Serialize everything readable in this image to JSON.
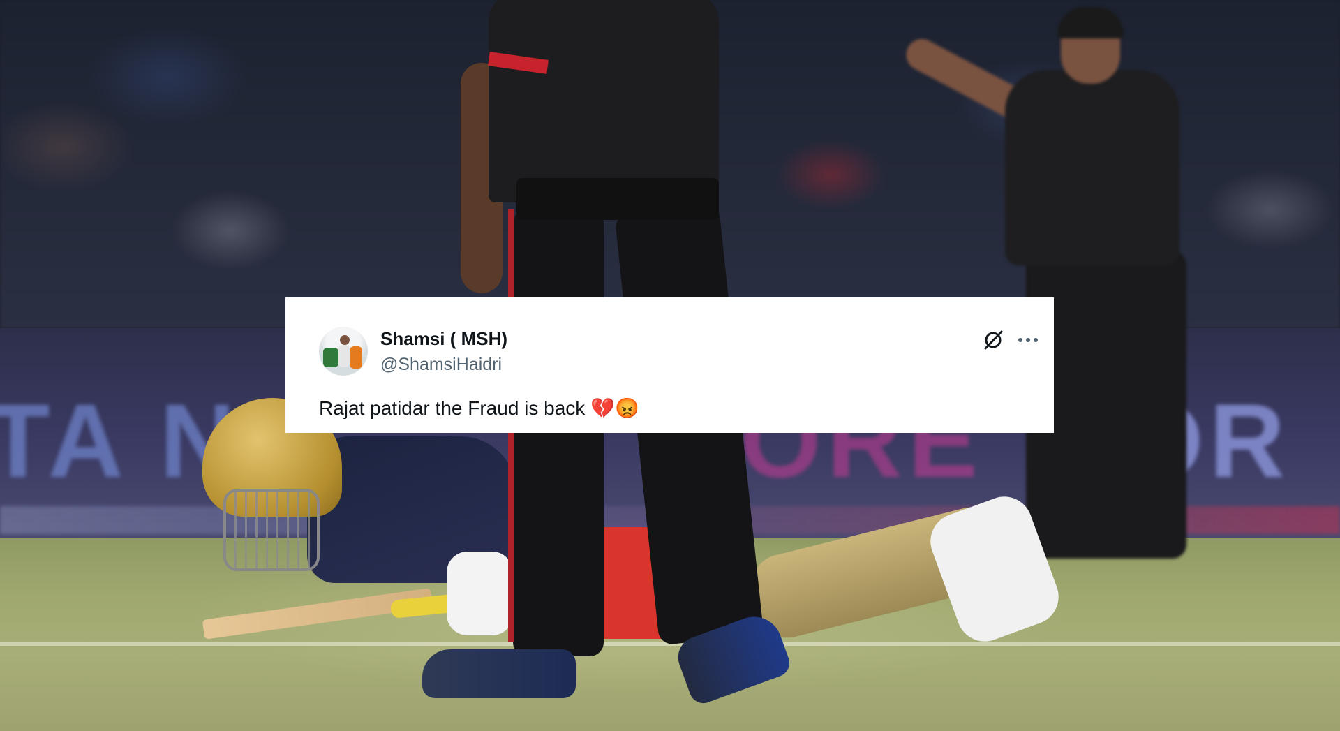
{
  "tweet": {
    "display_name": "Shamsi ( MSH)",
    "handle": "@ShamsiHaidri",
    "text": "Rajat patidar the Fraud is back 💔😡",
    "avatar_icon": "user-avatar",
    "grok_icon": "grok-icon",
    "more_icon": "more-options-icon"
  },
  "photo": {
    "scene": "cricket-match-photo"
  }
}
